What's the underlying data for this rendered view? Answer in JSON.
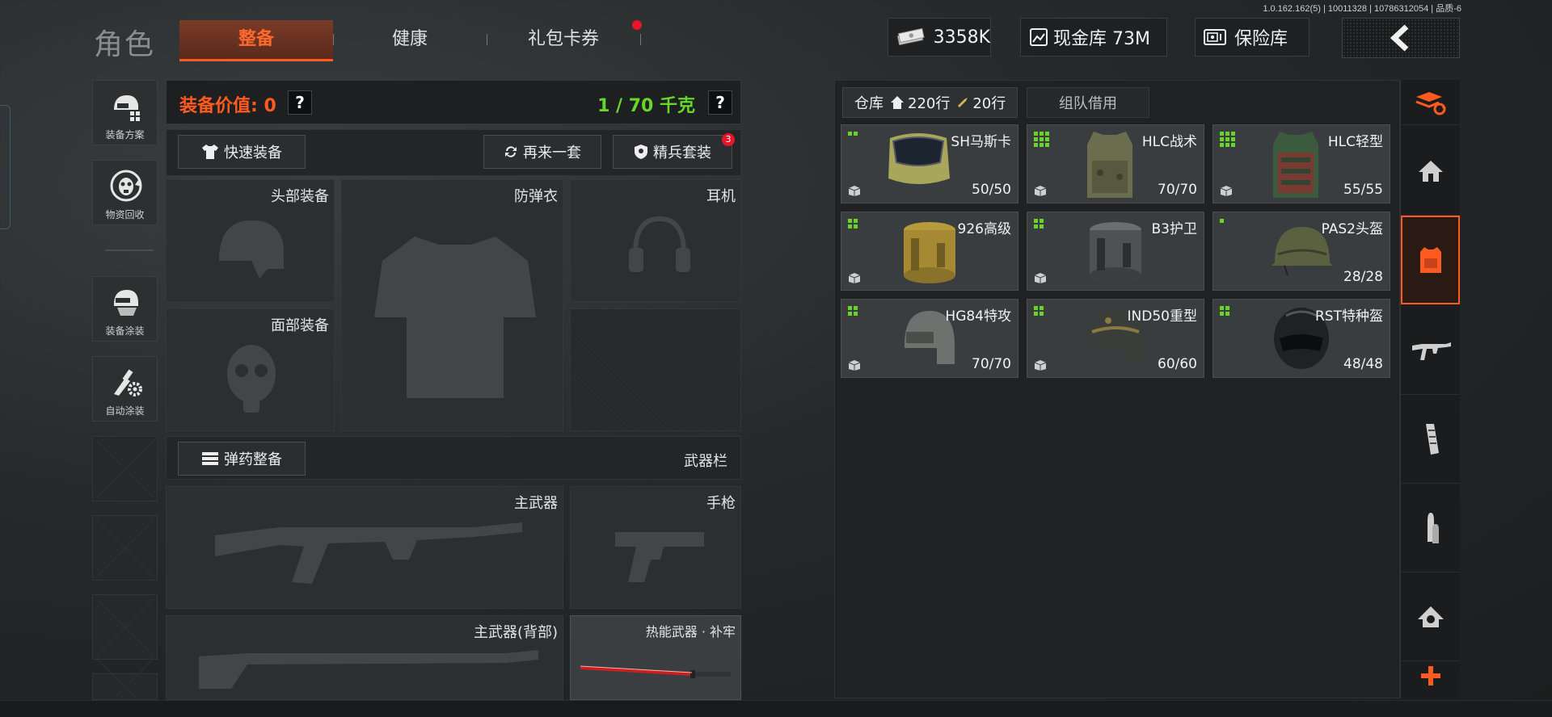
{
  "version": "1.0.162.162(5) | 10011328 | 10786312054 | 品质-6",
  "header": {
    "title": "角色",
    "tabs": [
      {
        "label": "整备",
        "active": true
      },
      {
        "label": "健康",
        "active": false
      },
      {
        "label": "礼包卡券",
        "active": false,
        "notification": true
      }
    ],
    "money": "3358K",
    "cash_vault": "现金库 73M",
    "safe": "保险库",
    "back_icon": "chevron-left-icon"
  },
  "left_nav": [
    {
      "label": "装备方案",
      "icon": "helmet-grid-icon"
    },
    {
      "label": "物资回收",
      "icon": "recycle-mask-icon"
    },
    {
      "label": "装备涂装",
      "icon": "paint-helmet-icon"
    },
    {
      "label": "自动涂装",
      "icon": "brush-gear-icon"
    }
  ],
  "equipment": {
    "value_label": "装备价值: 0",
    "weight": "1 / 70 千克",
    "help": "?",
    "quick_equip": "快速装备",
    "redo": "再来一套",
    "elite": "精兵套装",
    "elite_badge": "3",
    "slots": {
      "head": "头部装备",
      "armor": "防弹衣",
      "headset": "耳机",
      "face": "面部装备"
    },
    "ammo_button": "弹药整备",
    "weapon_bar": "武器栏",
    "weapons": {
      "primary": "主武器",
      "pistol": "手枪",
      "primary_back": "主武器(背部)",
      "thermal": "热能武器 · 补牢"
    }
  },
  "warehouse": {
    "tab_label": "仓库",
    "rows": "220行",
    "ammo_rows": "20行",
    "team_borrow": "组队借用",
    "items": [
      {
        "name": "SH马斯卡",
        "durability": "50/50",
        "size": "small"
      },
      {
        "name": "HLC战术",
        "durability": "70/70",
        "size": "large"
      },
      {
        "name": "HLC轻型",
        "durability": "55/55",
        "size": "large"
      },
      {
        "name": "926高级",
        "durability": "",
        "size": "small"
      },
      {
        "name": "B3护卫",
        "durability": "",
        "size": "small"
      },
      {
        "name": "PAS2头盔",
        "durability": "28/28",
        "size": "small"
      },
      {
        "name": "HG84特攻",
        "durability": "70/70",
        "size": "small"
      },
      {
        "name": "IND50重型",
        "durability": "60/60",
        "size": "small"
      },
      {
        "name": "RST特种盔",
        "durability": "48/48",
        "size": "small"
      }
    ]
  },
  "right_nav": [
    "stack-refresh-icon",
    "home-icon",
    "vest-icon",
    "rifle-icon",
    "magazine-icon",
    "bullet-icon",
    "scope-icon",
    "plus-icon"
  ],
  "colors": {
    "accent": "#ff5a1f",
    "weight_green": "#67d62a",
    "badge_red": "#e8142a"
  }
}
